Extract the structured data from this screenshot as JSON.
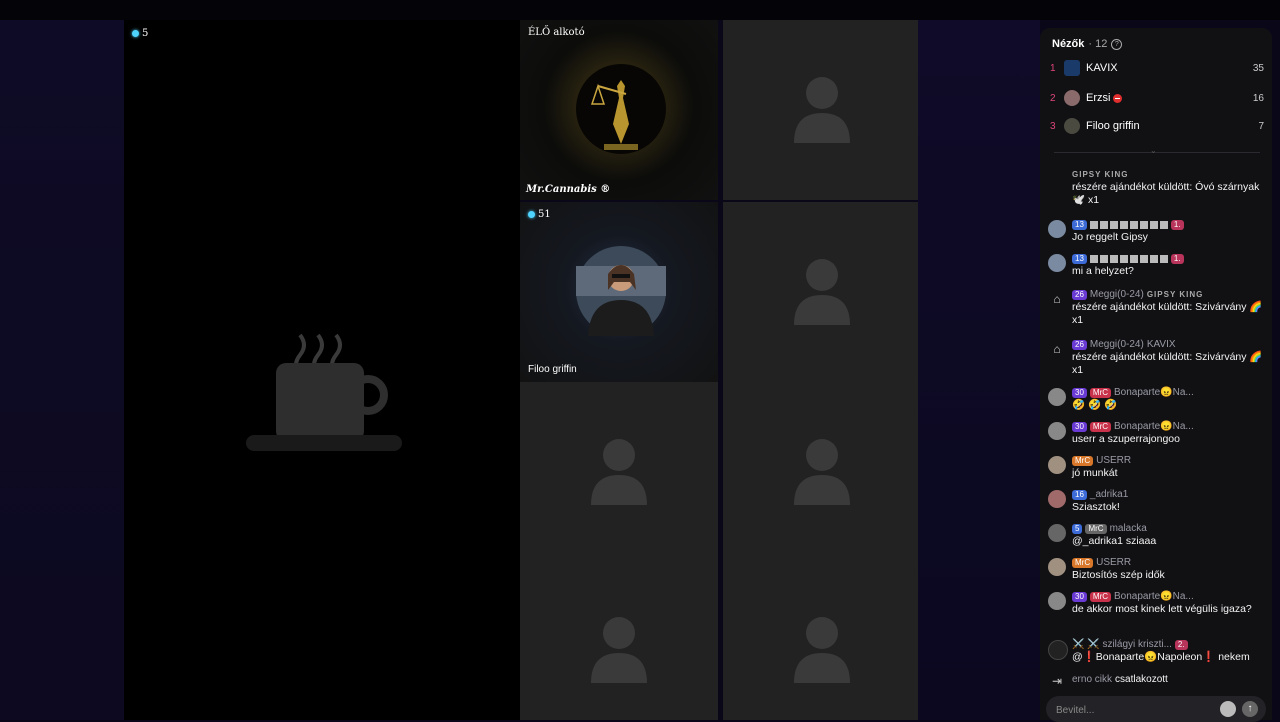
{
  "stage": {
    "badge_count": "5"
  },
  "tiles": {
    "host_label": "ÉLŐ alkotó",
    "host_name": "Mr.Cannabis ®",
    "guest_badge": "51",
    "guest_name": "Filoo griffin"
  },
  "panel": {
    "title": "Nézők",
    "count": "· 12",
    "top_viewers": [
      {
        "rank": "1",
        "name": "KAVIX",
        "score": "35"
      },
      {
        "rank": "2",
        "name": "Erzsi",
        "score": "16"
      },
      {
        "rank": "3",
        "name": "Filoo griffin",
        "score": "7"
      }
    ]
  },
  "chat": [
    {
      "user": "GIPSY KING",
      "text": "részére ajándékot küldött: Óvó szárnyak 🕊️ x1"
    },
    {
      "level": "13",
      "badge": "1.",
      "text": "Jo reggelt Gipsy"
    },
    {
      "level": "13",
      "badge": "1.",
      "text": "mi a helyzet?"
    },
    {
      "level": "26",
      "user": "Meggi(0-24)",
      "target": "GIPSY KING",
      "text": "részére ajándékot küldött: Szivárvány 🌈 x1"
    },
    {
      "level": "26",
      "user": "Meggi(0-24)",
      "target": "KAVIX",
      "text": "részére ajándékot küldött: Szivárvány 🌈 x1"
    },
    {
      "level": "30",
      "fan": "MrC",
      "user": "Bonaparte😠Na...",
      "text": "🤣 🤣 🤣"
    },
    {
      "level": "30",
      "fan": "MrC",
      "user": "Bonaparte😠Na...",
      "text": "userr a szuperrajongoo"
    },
    {
      "fan": "MrC",
      "user": "USERR",
      "text": "jó munkát"
    },
    {
      "level": "16",
      "user": "_adrika1",
      "text": "Sziasztok!"
    },
    {
      "level": "5",
      "fan": "MrC",
      "user": "malacka",
      "text": "@_adrika1 sziaaa"
    },
    {
      "fan": "MrC",
      "user": "USERR",
      "text": "Biztosítós szép idők"
    },
    {
      "level": "30",
      "fan": "MrC",
      "user": "Bonaparte😠Na...",
      "text": "de akkor most kinek lett végülis igaza?"
    },
    {
      "user": "⚔️ ⚔️ szilágyi kriszti...",
      "badge": "2.",
      "text": "@❗Bonaparte😠Napoleon❗ nekem"
    },
    {
      "user": "erno cikk",
      "text": "csatlakozott"
    }
  ],
  "input": {
    "placeholder": "Bevitel..."
  },
  "colors": {
    "accent": "#e0457b",
    "live_dot": "#4fd4ff",
    "panel_bg": "#111114"
  }
}
